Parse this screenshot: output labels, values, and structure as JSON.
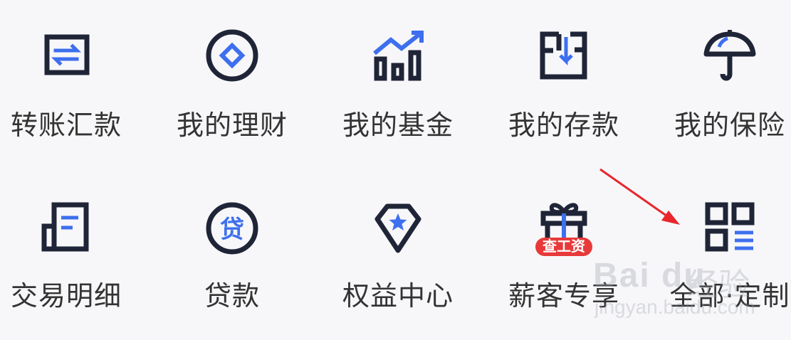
{
  "row1": [
    {
      "label": "转账汇款",
      "icon": "transfer-icon"
    },
    {
      "label": "我的理财",
      "icon": "wealth-icon"
    },
    {
      "label": "我的基金",
      "icon": "fund-chart-icon"
    },
    {
      "label": "我的存款",
      "icon": "deposit-icon"
    },
    {
      "label": "我的保险",
      "icon": "umbrella-icon"
    }
  ],
  "row2": [
    {
      "label": "交易明细",
      "icon": "transaction-details-icon"
    },
    {
      "label": "贷款",
      "icon": "loan-icon",
      "icon_text": "贷"
    },
    {
      "label": "权益中心",
      "icon": "diamond-star-icon"
    },
    {
      "label": "薪客专享",
      "icon": "gift-icon",
      "badge": "查工资"
    },
    {
      "label": "全部·定制",
      "icon": "all-services-grid-icon"
    }
  ],
  "watermark": {
    "logo": "Bai du",
    "cn": "经验",
    "url": "jingyan.baidu.com"
  },
  "colors": {
    "icon_dark": "#1f2537",
    "icon_blue": "#3d6fee",
    "label": "#333333",
    "badge": "#e8393a",
    "annotation_arrow": "#e8262b"
  }
}
